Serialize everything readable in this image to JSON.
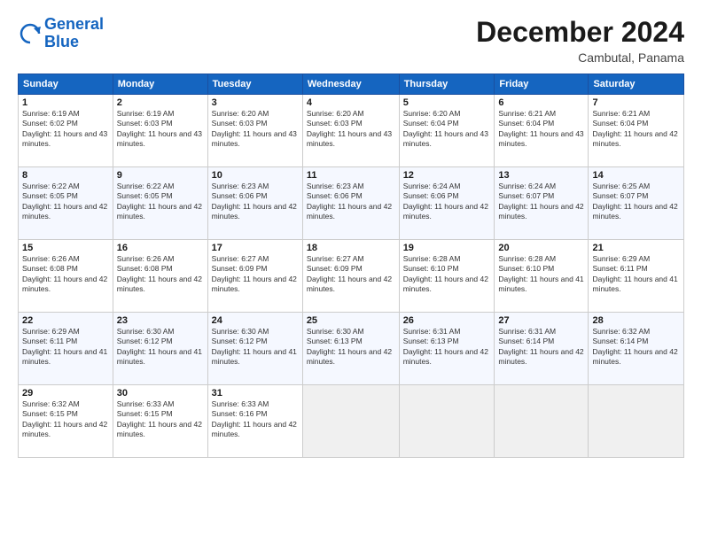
{
  "logo": {
    "line1": "General",
    "line2": "Blue"
  },
  "title": "December 2024",
  "location": "Cambutal, Panama",
  "days_of_week": [
    "Sunday",
    "Monday",
    "Tuesday",
    "Wednesday",
    "Thursday",
    "Friday",
    "Saturday"
  ],
  "weeks": [
    [
      {
        "num": "1",
        "rise": "6:19 AM",
        "set": "6:02 PM",
        "daylight": "11 hours and 43 minutes."
      },
      {
        "num": "2",
        "rise": "6:19 AM",
        "set": "6:03 PM",
        "daylight": "11 hours and 43 minutes."
      },
      {
        "num": "3",
        "rise": "6:20 AM",
        "set": "6:03 PM",
        "daylight": "11 hours and 43 minutes."
      },
      {
        "num": "4",
        "rise": "6:20 AM",
        "set": "6:03 PM",
        "daylight": "11 hours and 43 minutes."
      },
      {
        "num": "5",
        "rise": "6:20 AM",
        "set": "6:04 PM",
        "daylight": "11 hours and 43 minutes."
      },
      {
        "num": "6",
        "rise": "6:21 AM",
        "set": "6:04 PM",
        "daylight": "11 hours and 43 minutes."
      },
      {
        "num": "7",
        "rise": "6:21 AM",
        "set": "6:04 PM",
        "daylight": "11 hours and 42 minutes."
      }
    ],
    [
      {
        "num": "8",
        "rise": "6:22 AM",
        "set": "6:05 PM",
        "daylight": "11 hours and 42 minutes."
      },
      {
        "num": "9",
        "rise": "6:22 AM",
        "set": "6:05 PM",
        "daylight": "11 hours and 42 minutes."
      },
      {
        "num": "10",
        "rise": "6:23 AM",
        "set": "6:06 PM",
        "daylight": "11 hours and 42 minutes."
      },
      {
        "num": "11",
        "rise": "6:23 AM",
        "set": "6:06 PM",
        "daylight": "11 hours and 42 minutes."
      },
      {
        "num": "12",
        "rise": "6:24 AM",
        "set": "6:06 PM",
        "daylight": "11 hours and 42 minutes."
      },
      {
        "num": "13",
        "rise": "6:24 AM",
        "set": "6:07 PM",
        "daylight": "11 hours and 42 minutes."
      },
      {
        "num": "14",
        "rise": "6:25 AM",
        "set": "6:07 PM",
        "daylight": "11 hours and 42 minutes."
      }
    ],
    [
      {
        "num": "15",
        "rise": "6:26 AM",
        "set": "6:08 PM",
        "daylight": "11 hours and 42 minutes."
      },
      {
        "num": "16",
        "rise": "6:26 AM",
        "set": "6:08 PM",
        "daylight": "11 hours and 42 minutes."
      },
      {
        "num": "17",
        "rise": "6:27 AM",
        "set": "6:09 PM",
        "daylight": "11 hours and 42 minutes."
      },
      {
        "num": "18",
        "rise": "6:27 AM",
        "set": "6:09 PM",
        "daylight": "11 hours and 42 minutes."
      },
      {
        "num": "19",
        "rise": "6:28 AM",
        "set": "6:10 PM",
        "daylight": "11 hours and 42 minutes."
      },
      {
        "num": "20",
        "rise": "6:28 AM",
        "set": "6:10 PM",
        "daylight": "11 hours and 41 minutes."
      },
      {
        "num": "21",
        "rise": "6:29 AM",
        "set": "6:11 PM",
        "daylight": "11 hours and 41 minutes."
      }
    ],
    [
      {
        "num": "22",
        "rise": "6:29 AM",
        "set": "6:11 PM",
        "daylight": "11 hours and 41 minutes."
      },
      {
        "num": "23",
        "rise": "6:30 AM",
        "set": "6:12 PM",
        "daylight": "11 hours and 41 minutes."
      },
      {
        "num": "24",
        "rise": "6:30 AM",
        "set": "6:12 PM",
        "daylight": "11 hours and 41 minutes."
      },
      {
        "num": "25",
        "rise": "6:30 AM",
        "set": "6:13 PM",
        "daylight": "11 hours and 42 minutes."
      },
      {
        "num": "26",
        "rise": "6:31 AM",
        "set": "6:13 PM",
        "daylight": "11 hours and 42 minutes."
      },
      {
        "num": "27",
        "rise": "6:31 AM",
        "set": "6:14 PM",
        "daylight": "11 hours and 42 minutes."
      },
      {
        "num": "28",
        "rise": "6:32 AM",
        "set": "6:14 PM",
        "daylight": "11 hours and 42 minutes."
      }
    ],
    [
      {
        "num": "29",
        "rise": "6:32 AM",
        "set": "6:15 PM",
        "daylight": "11 hours and 42 minutes."
      },
      {
        "num": "30",
        "rise": "6:33 AM",
        "set": "6:15 PM",
        "daylight": "11 hours and 42 minutes."
      },
      {
        "num": "31",
        "rise": "6:33 AM",
        "set": "6:16 PM",
        "daylight": "11 hours and 42 minutes."
      },
      null,
      null,
      null,
      null
    ]
  ]
}
